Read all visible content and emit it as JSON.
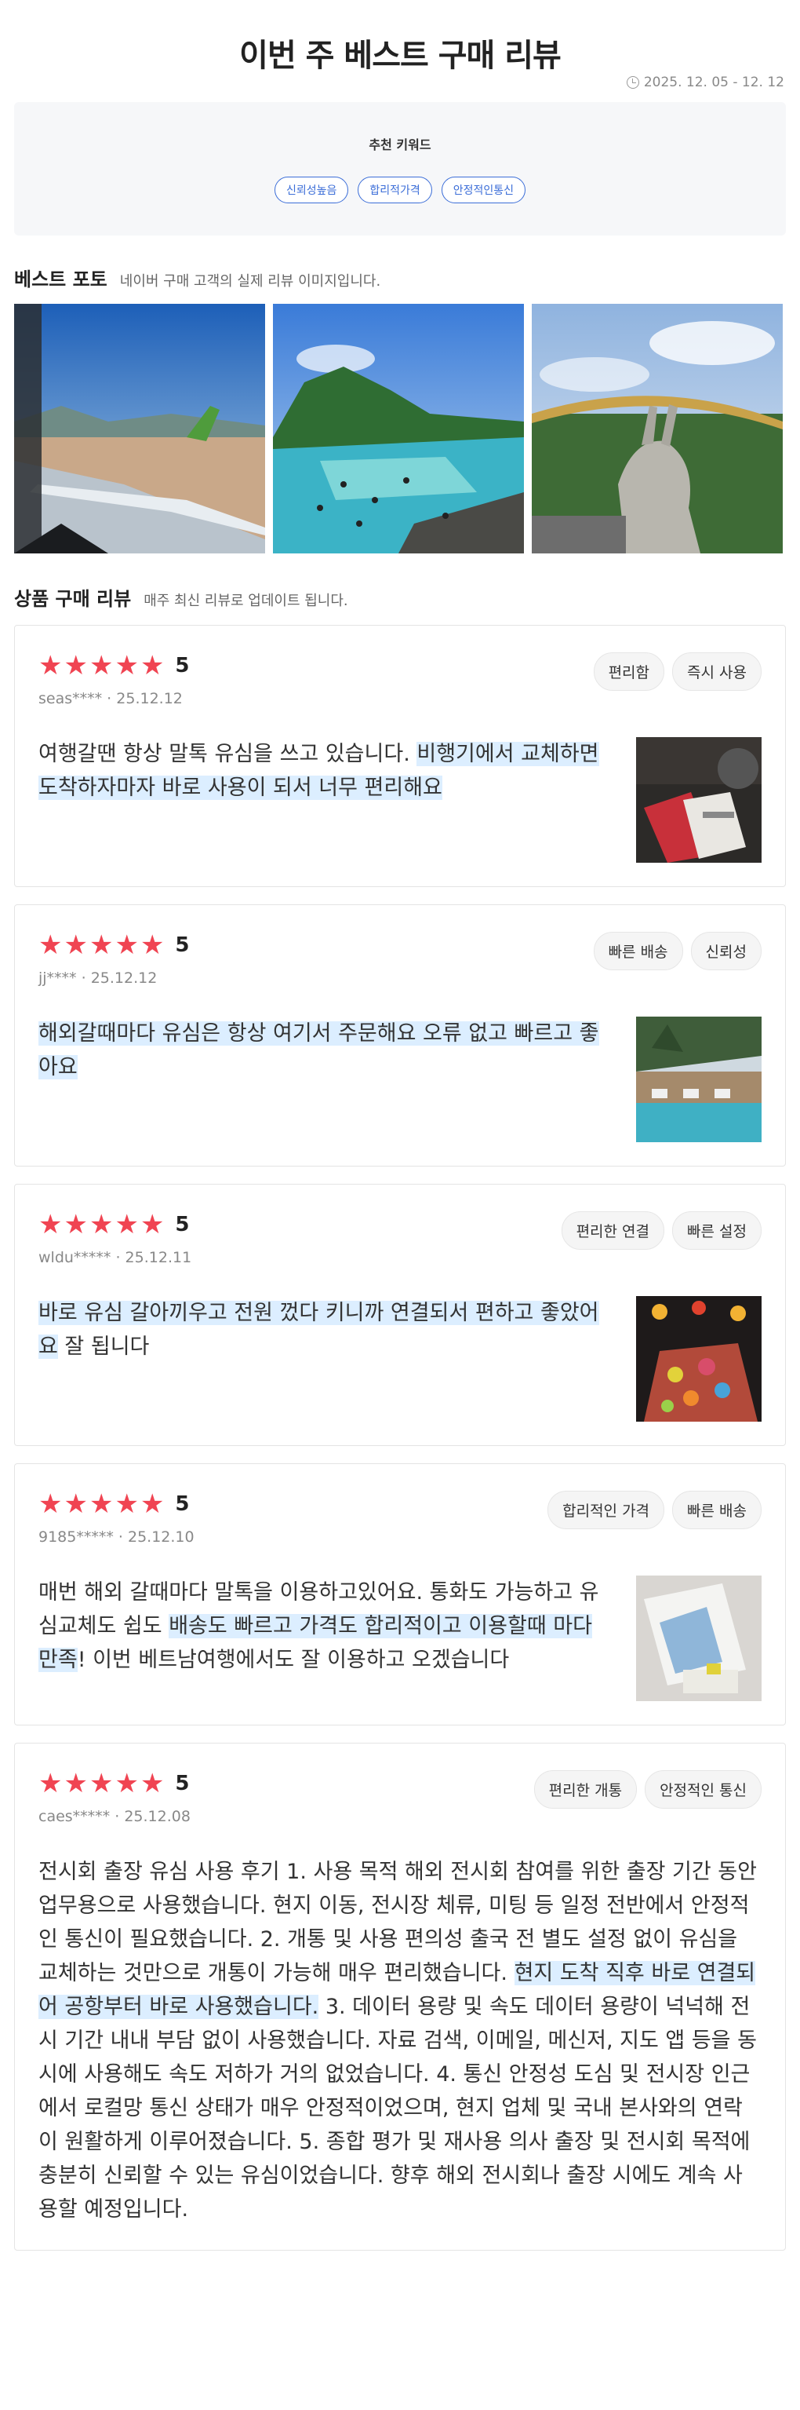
{
  "page": {
    "title": "이번 주 베스트 구매 리뷰",
    "date_range": "2025. 12. 05 - 12. 12"
  },
  "keywords": {
    "title": "추천 키워드",
    "items": [
      "신뢰성높음",
      "합리적가격",
      "안정적인통신"
    ]
  },
  "best_photo": {
    "title": "베스트 포토",
    "desc": "네이버 구매 고객의 실제 리뷰 이미지입니다."
  },
  "reviews_section": {
    "title": "상품 구매 리뷰",
    "desc": "매주 최신 리뷰로 업데이트 됩니다."
  },
  "reviews": [
    {
      "rating": 5,
      "score": "5",
      "user": "seas****",
      "date": "25.12.12",
      "tags": [
        "편리함",
        "즉시 사용"
      ],
      "pre": "여행갈땐 항상 말톡 유심을 쓰고 있습니다. ",
      "highlight": "비행기에서 교체하면 도착하자마자 바로 사용이 되서 너무 편리해요",
      "post": ""
    },
    {
      "rating": 5,
      "score": "5",
      "user": "jj****",
      "date": "25.12.12",
      "tags": [
        "빠른 배송",
        "신뢰성"
      ],
      "pre": "",
      "highlight": "해외갈때마다 유심은 항상 여기서 주문해요 오류 없고 빠르고 좋아요",
      "post": ""
    },
    {
      "rating": 5,
      "score": "5",
      "user": "wldu*****",
      "date": "25.12.11",
      "tags": [
        "편리한 연결",
        "빠른 설정"
      ],
      "pre": "",
      "highlight": "바로 유심 갈아끼우고 전원 껐다 키니까 연결되서 편하고 좋았어요",
      "post": " 잘 됩니다"
    },
    {
      "rating": 5,
      "score": "5",
      "user": "9185*****",
      "date": "25.12.10",
      "tags": [
        "합리적인 가격",
        "빠른 배송"
      ],
      "pre": "매번 해외 갈때마다 말톡을 이용하고있어요. 통화도 가능하고 유심교체도 쉽도 ",
      "highlight": "배송도 빠르고 가격도 합리적이고 이용할때 마다 만족",
      "post": "! 이번 베트남여행에서도 잘 이용하고 오겠습니다"
    },
    {
      "rating": 5,
      "score": "5",
      "user": "caes*****",
      "date": "25.12.08",
      "tags": [
        "편리한 개통",
        "안정적인 통신"
      ],
      "pre": "전시회 출장 유심 사용 후기 1. 사용 목적 해외 전시회 참여를 위한 출장 기간 동안 업무용으로 사용했습니다. 현지 이동, 전시장 체류, 미팅 등 일정 전반에서 안정적인 통신이 필요했습니다. 2. 개통 및 사용 편의성 출국 전 별도 설정 없이 유심을 교체하는 것만으로 개통이 가능해 매우 편리했습니다. ",
      "highlight": "현지 도착 직후 바로 연결되어 공항부터 바로 사용했습니다.",
      "post": " 3. 데이터 용량 및 속도 데이터 용량이 넉넉해 전시 기간 내내 부담 없이 사용했습니다. 자료 검색, 이메일, 메신저, 지도 앱 등을 동시에 사용해도 속도 저하가 거의 없었습니다. 4. 통신 안정성 도심 및 전시장 인근에서 로컬망 통신 상태가 매우 안정적이었으며, 현지 업체 및 국내 본사와의 연락이 원활하게 이루어졌습니다. 5. 종합 평가 및 재사용 의사 출장 및 전시회 목적에 충분히 신뢰할 수 있는 유심이었습니다. 향후 해외 전시회나 출장 시에도 계속 사용할 예정입니다."
    }
  ]
}
